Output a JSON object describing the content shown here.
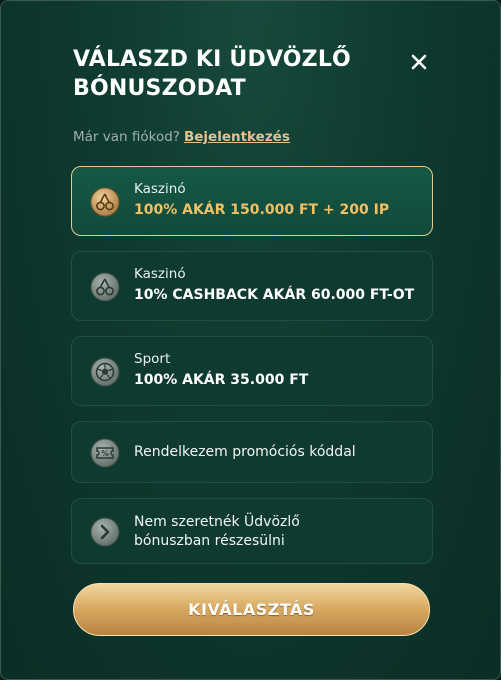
{
  "modal": {
    "title_line1": "VÁLASZD KI ÜDVÖZLŐ",
    "title_line2": "BÓNUSZODAT",
    "login_prompt": "Már van fiókod?",
    "login_link": "Bejelentkezés"
  },
  "options": [
    {
      "icon": "cherries-icon",
      "label": "Kaszinó",
      "value": "100% AKÁR 150.000 FT + 200 IP",
      "selected": true
    },
    {
      "icon": "cherries-icon",
      "label": "Kaszinó",
      "value": "10% CASHBACK AKÁR 60.000 FT-OT",
      "selected": false
    },
    {
      "icon": "soccer-ball-icon",
      "label": "Sport",
      "value": "100% AKÁR 35.000 FT",
      "selected": false
    },
    {
      "icon": "promo-code-ticket-icon",
      "label": "Rendelkezem promóciós kóddal",
      "selected": false
    },
    {
      "icon": "chevron-right-icon",
      "label": "Nem szeretnék Üdvözlő bónuszban részesülni",
      "selected": false
    }
  ],
  "actions": {
    "select_button": "KIVÁLASZTÁS"
  },
  "colors": {
    "accent_gold": "#e7c18a",
    "selected_value": "#f0c064",
    "background": "#0f3a2f"
  }
}
